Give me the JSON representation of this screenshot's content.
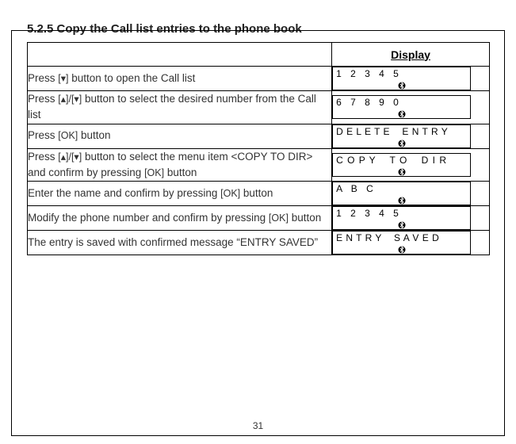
{
  "heading": "5.2.5  Copy the Call list entries to the phone book",
  "header": {
    "display_label": "Display"
  },
  "keys": {
    "down": "[▾]",
    "updown": "[▴]/[▾]",
    "ok": "[OK]"
  },
  "rows": [
    {
      "instr_pre": "Press ",
      "key1": "down",
      "instr_mid": " button to open the Call list",
      "key2": null,
      "instr_post": "",
      "display": "1 2 3 4 5"
    },
    {
      "instr_pre": "Press ",
      "key1": "updown",
      "instr_mid": " button to select the desired number from the Call list",
      "key2": null,
      "instr_post": "",
      "display": "6 7 8 9 0"
    },
    {
      "instr_pre": "Press ",
      "key1": "ok",
      "instr_mid": " button",
      "key2": null,
      "instr_post": "",
      "display": "D E L E T E    E N T R Y"
    },
    {
      "instr_pre": "Press ",
      "key1": "updown",
      "instr_mid": " button to select the menu item <COPY TO DIR> and confirm by pressing ",
      "key2": "ok",
      "instr_post": " button",
      "display": "C O P Y    T O    D I R"
    },
    {
      "instr_pre": "Enter the name and confirm by pressing ",
      "key1": "ok",
      "instr_mid": " button",
      "key2": null,
      "instr_post": "",
      "display": "A B C"
    },
    {
      "instr_pre": "Modify the phone number and confirm by pressing ",
      "key1": "ok",
      "instr_mid": " button",
      "key2": null,
      "instr_post": "",
      "display": "1 2 3 4 5"
    },
    {
      "instr_pre": "The entry is saved  with confirmed message “ENTRY SAVED”",
      "key1": null,
      "instr_mid": "",
      "key2": null,
      "instr_post": "",
      "display": "E N T R Y    S A V E D"
    }
  ],
  "page_number": "31"
}
